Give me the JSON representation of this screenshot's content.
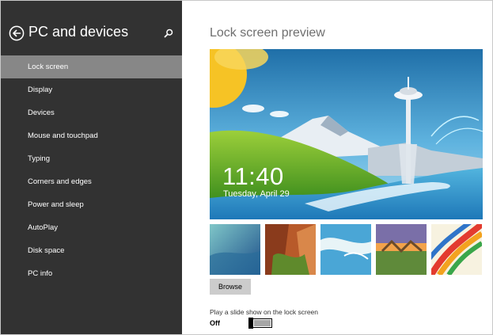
{
  "sidebar": {
    "title": "PC and devices",
    "items": [
      {
        "label": "Lock screen",
        "selected": true
      },
      {
        "label": "Display"
      },
      {
        "label": "Devices"
      },
      {
        "label": "Mouse and touchpad"
      },
      {
        "label": "Typing"
      },
      {
        "label": "Corners and edges"
      },
      {
        "label": "Power and sleep"
      },
      {
        "label": "AutoPlay"
      },
      {
        "label": "Disk space"
      },
      {
        "label": "PC info"
      }
    ],
    "icons": {
      "back": "back-arrow-icon",
      "search": "search-icon"
    }
  },
  "main": {
    "title": "Lock screen preview",
    "preview": {
      "time": "11:40",
      "date": "Tuesday, April 29"
    },
    "thumbnails": [
      "wave-thumbnail",
      "canyon-thumbnail",
      "beach-thumbnail",
      "fence-sunset-thumbnail",
      "color-stripes-thumbnail"
    ],
    "browse_label": "Browse",
    "slideshow": {
      "label": "Play a slide show on the lock screen",
      "state": "Off"
    }
  },
  "colors": {
    "sidebar_bg": "#323232",
    "selected_bg": "#878787",
    "title_gray": "#6f6f6f"
  }
}
